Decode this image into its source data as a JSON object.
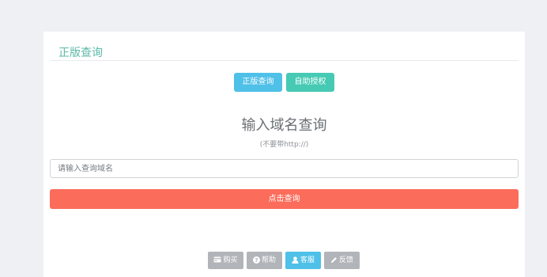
{
  "panel": {
    "title": "正版查询"
  },
  "tabs": {
    "genuine_label": "正版查询",
    "auth_label": "自助授权"
  },
  "query": {
    "title": "输入域名查询",
    "hint": "(不要带http://)",
    "placeholder": "请输入查询域名",
    "value": "",
    "submit_label": "点击查询"
  },
  "footer": {
    "buttons": [
      {
        "label": "购买",
        "icon": "card-icon"
      },
      {
        "label": "帮助",
        "icon": "question-circle-icon"
      },
      {
        "label": "客服",
        "icon": "user-icon"
      },
      {
        "label": "反馈",
        "icon": "pencil-icon"
      }
    ]
  },
  "colors": {
    "page_bg": "#eef0f4",
    "title_green": "#5bb8a7",
    "btn_blue": "#4fc0e8",
    "btn_teal": "#46cab4",
    "submit_red": "#fc6c5b",
    "btn_gray": "#b1b4b8"
  }
}
